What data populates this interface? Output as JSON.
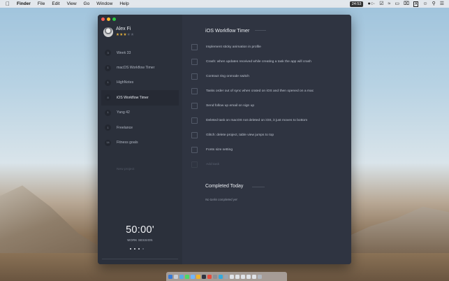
{
  "menubar": {
    "apple_icon": "apple-icon",
    "app_name": "Finder",
    "menus": [
      "File",
      "Edit",
      "View",
      "Go",
      "Window",
      "Help"
    ],
    "clock_badge": "24:53",
    "input_source": "A"
  },
  "sidebar": {
    "user": {
      "name": "Alex Fi",
      "rating": 3,
      "rating_max": 5
    },
    "projects": [
      {
        "count": "3",
        "label": "Week 33",
        "active": false
      },
      {
        "count": "1",
        "label": "macOS Workflow Timer",
        "active": false
      },
      {
        "count": "1",
        "label": "HighNotes",
        "active": false
      },
      {
        "count": "8",
        "label": "iOS Workflow Timer",
        "active": true
      },
      {
        "count": "1",
        "label": "Yang 42",
        "active": false
      },
      {
        "count": "1",
        "label": "Freelance",
        "active": false
      },
      {
        "count": "14",
        "label": "Fitness goals",
        "active": false
      }
    ],
    "new_project_placeholder": "New project",
    "timer": {
      "time": "50:00'",
      "label": "WORK SESSION",
      "sessions_done": 3,
      "sessions_total": 4
    }
  },
  "main": {
    "title": "iOS Workflow Timer",
    "tasks": [
      "Implement sticky animation in profile",
      "Crash: when updates received while creating a task the app will crash",
      "Contract ring onmode switch",
      "Tasks order out of sync when crated on iOS and then opened on a mac",
      "Send follow up email on sign up",
      "Deleted task on macOS not deleted on iOS, it just moves to bottom",
      "Glitch: delete project, table view jumps to top",
      "Fonts size setting"
    ],
    "add_task_placeholder": "Add task",
    "completed_title": "Completed Today",
    "completed_empty": "No tasks completed yet"
  },
  "colors": {
    "window_bg": "#2f3441",
    "sidebar_bg": "#2b303b",
    "star": "#e9b43c",
    "close": "#fc5f57",
    "minimize": "#fdbc2e",
    "maximize": "#28c840"
  }
}
